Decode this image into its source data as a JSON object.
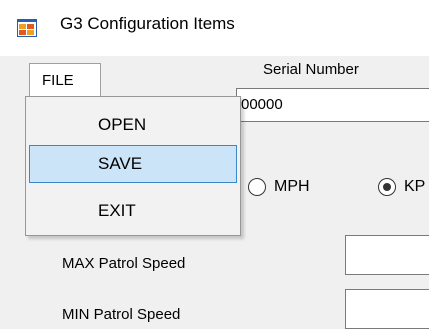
{
  "window": {
    "title": "G3 Configuration Items",
    "icon": "app-window-icon"
  },
  "menu": {
    "file_label": "FILE",
    "items": [
      {
        "label": "OPEN"
      },
      {
        "label": "SAVE"
      },
      {
        "label": "EXIT"
      }
    ]
  },
  "serial": {
    "label": "Serial Number",
    "value": "00000"
  },
  "units": {
    "options": [
      {
        "label": "MPH",
        "checked": false
      },
      {
        "label": "KP",
        "checked": true
      }
    ]
  },
  "fields": {
    "max_patrol_label": "MAX Patrol Speed",
    "min_patrol_label": "MIN Patrol Speed"
  },
  "colors": {
    "highlight": "#cce4f7",
    "highlight_border": "#3c87c7"
  }
}
